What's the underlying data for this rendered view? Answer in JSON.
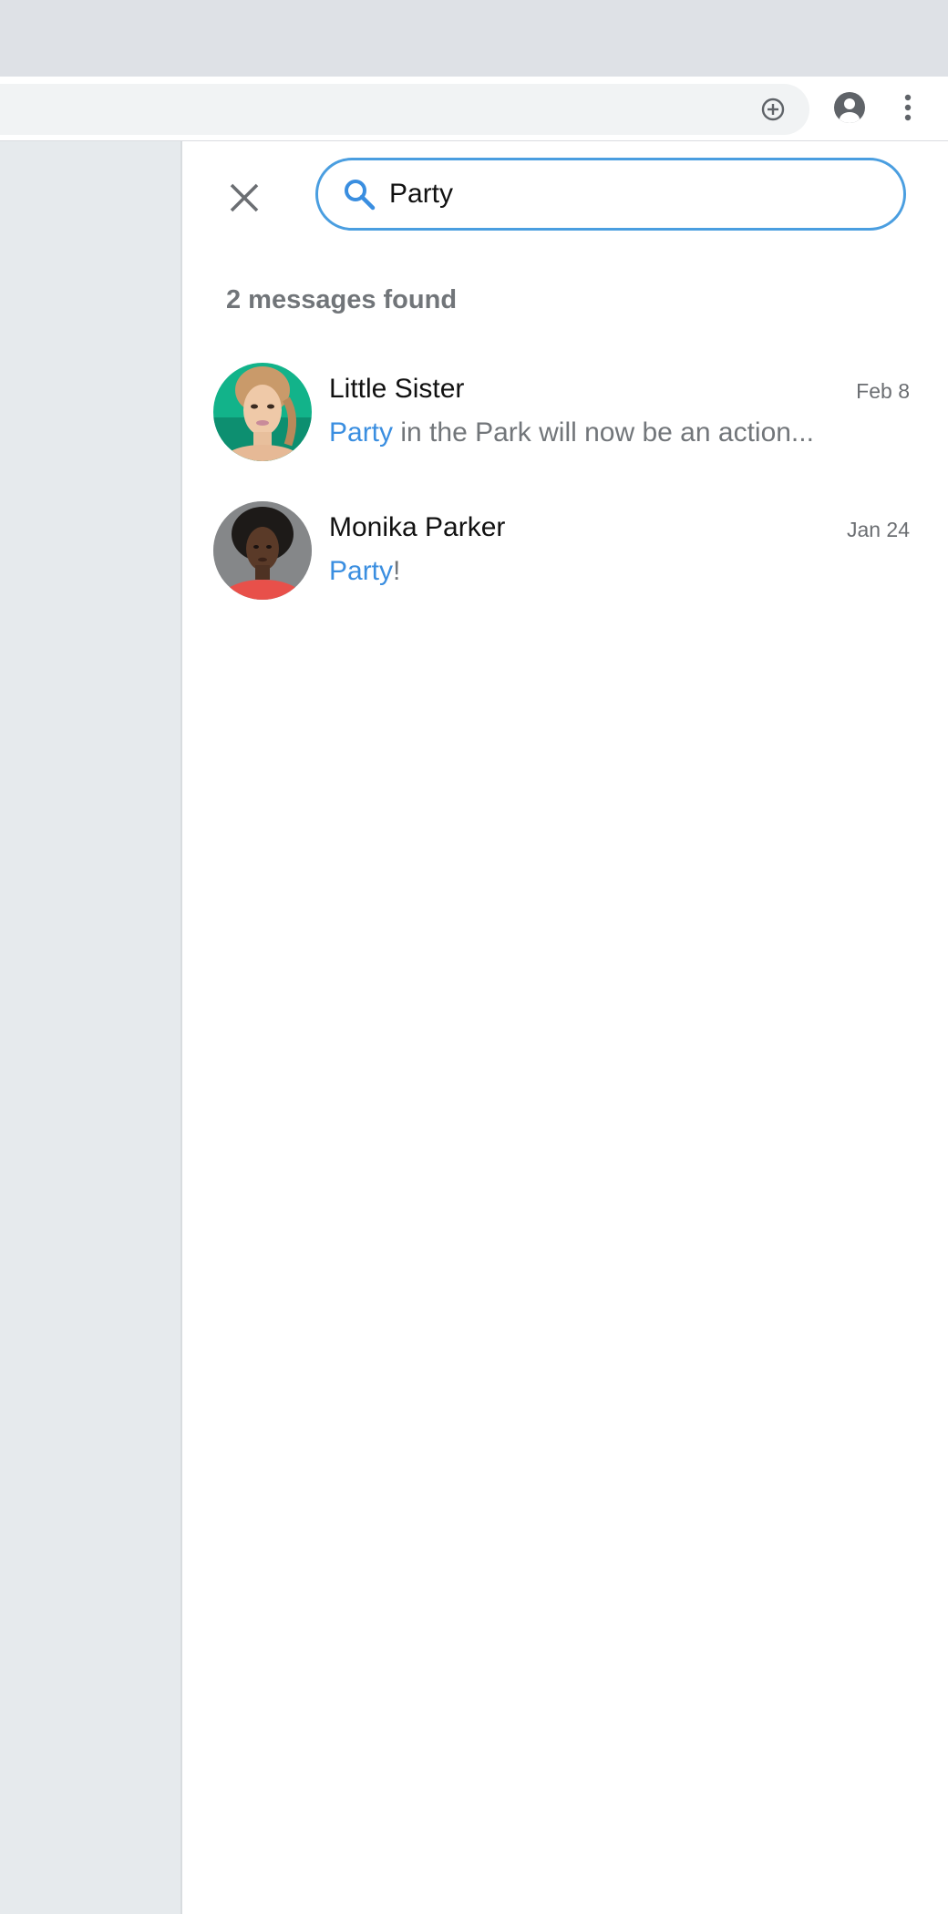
{
  "search": {
    "query": "Party",
    "results_count_text": "2 messages found"
  },
  "results": [
    {
      "name": "Little Sister",
      "date": "Feb 8",
      "match": "Party",
      "rest": " in the Park will now be an action..."
    },
    {
      "name": "Monika Parker",
      "date": "Jan 24",
      "match": "Party",
      "rest": "!"
    }
  ],
  "colors": {
    "accent": "#4a9ee0",
    "highlight": "#3a8ee0",
    "tabstrip": "#dee1e6",
    "omnibox": "#f1f3f4",
    "left_pane": "#e6eaed"
  },
  "icons": {
    "toolbar": [
      "add-circle-icon",
      "account-circle-icon",
      "more-vert-icon"
    ],
    "search_panel": [
      "close-icon",
      "search-icon"
    ]
  }
}
